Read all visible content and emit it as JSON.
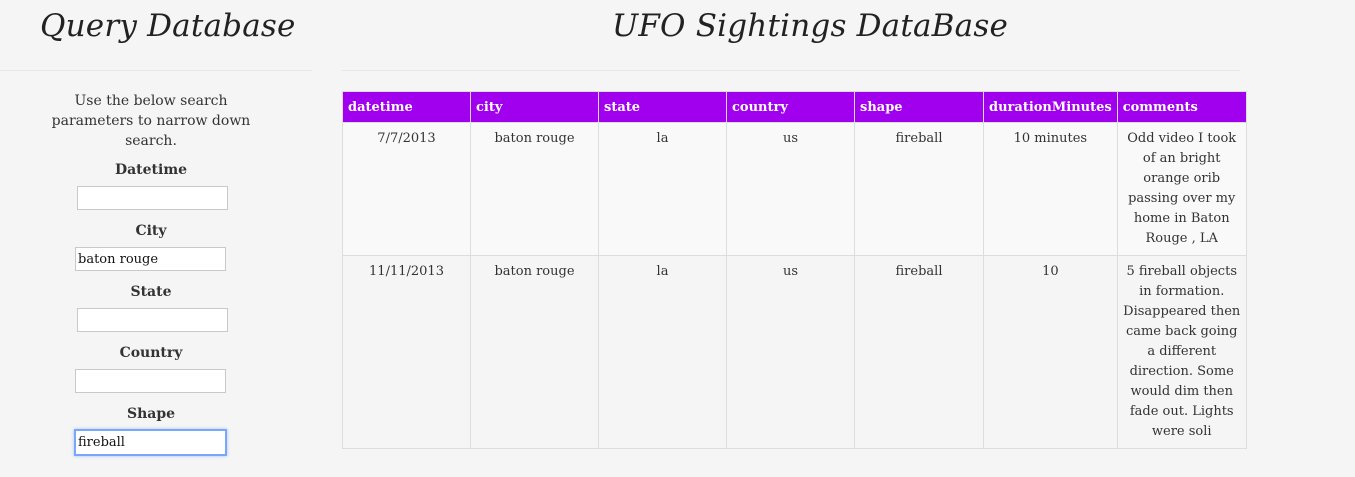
{
  "sidebar": {
    "title": "Query Database",
    "instructions": "Use the below search parameters to narrow down search.",
    "fields": [
      {
        "label": "Datetime",
        "value": "",
        "focused": false
      },
      {
        "label": "City",
        "value": "baton rouge",
        "focused": false
      },
      {
        "label": "State",
        "value": "",
        "focused": false
      },
      {
        "label": "Country",
        "value": "",
        "focused": false
      },
      {
        "label": "Shape",
        "value": "fireball",
        "focused": true
      }
    ]
  },
  "main": {
    "title": "UFO Sightings DataBase",
    "table": {
      "headers": [
        "datetime",
        "city",
        "state",
        "country",
        "shape",
        "durationMinutes",
        "comments"
      ],
      "rows": [
        [
          "7/7/2013",
          "baton rouge",
          "la",
          "us",
          "fireball",
          "10 minutes",
          "Odd video I took of an bright orange orib passing over my home in Baton Rouge , LA"
        ],
        [
          "11/11/2013",
          "baton rouge",
          "la",
          "us",
          "fireball",
          "10",
          "5 fireball objects in formation. Disappeared then came back going a different direction. Some would dim then fade out. Lights were soli"
        ]
      ]
    },
    "header_color": "#a000ed"
  }
}
